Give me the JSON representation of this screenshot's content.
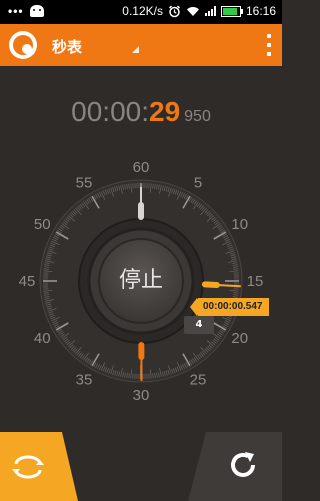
{
  "status_bar": {
    "dots": "•••",
    "speed": "0.12K/s",
    "time": "16:16",
    "icons": [
      "android-icon",
      "alarm-icon",
      "wifi-icon",
      "signal-icon",
      "battery-icon"
    ]
  },
  "app_bar": {
    "title": "秒表",
    "logo_icon": "stopwatch-logo-icon",
    "menu_icon": "overflow-menu-icon",
    "accent_color": "#f07814"
  },
  "timer": {
    "hours_minutes": "00:00:",
    "seconds": "29",
    "milliseconds": "950"
  },
  "dial": {
    "labels": [
      "60",
      "5",
      "10",
      "15",
      "20",
      "25",
      "30",
      "35",
      "40",
      "45",
      "50",
      "55"
    ],
    "center_button": "停止",
    "main_hand_seconds": 29.95,
    "lap_hand_seconds": 15.5
  },
  "lap": {
    "time": "00:00:00.547",
    "count": "4"
  },
  "bottom_bar": {
    "left_icon": "lap-reset-icon",
    "right_icon": "refresh-icon",
    "left_color": "#f5a623"
  }
}
